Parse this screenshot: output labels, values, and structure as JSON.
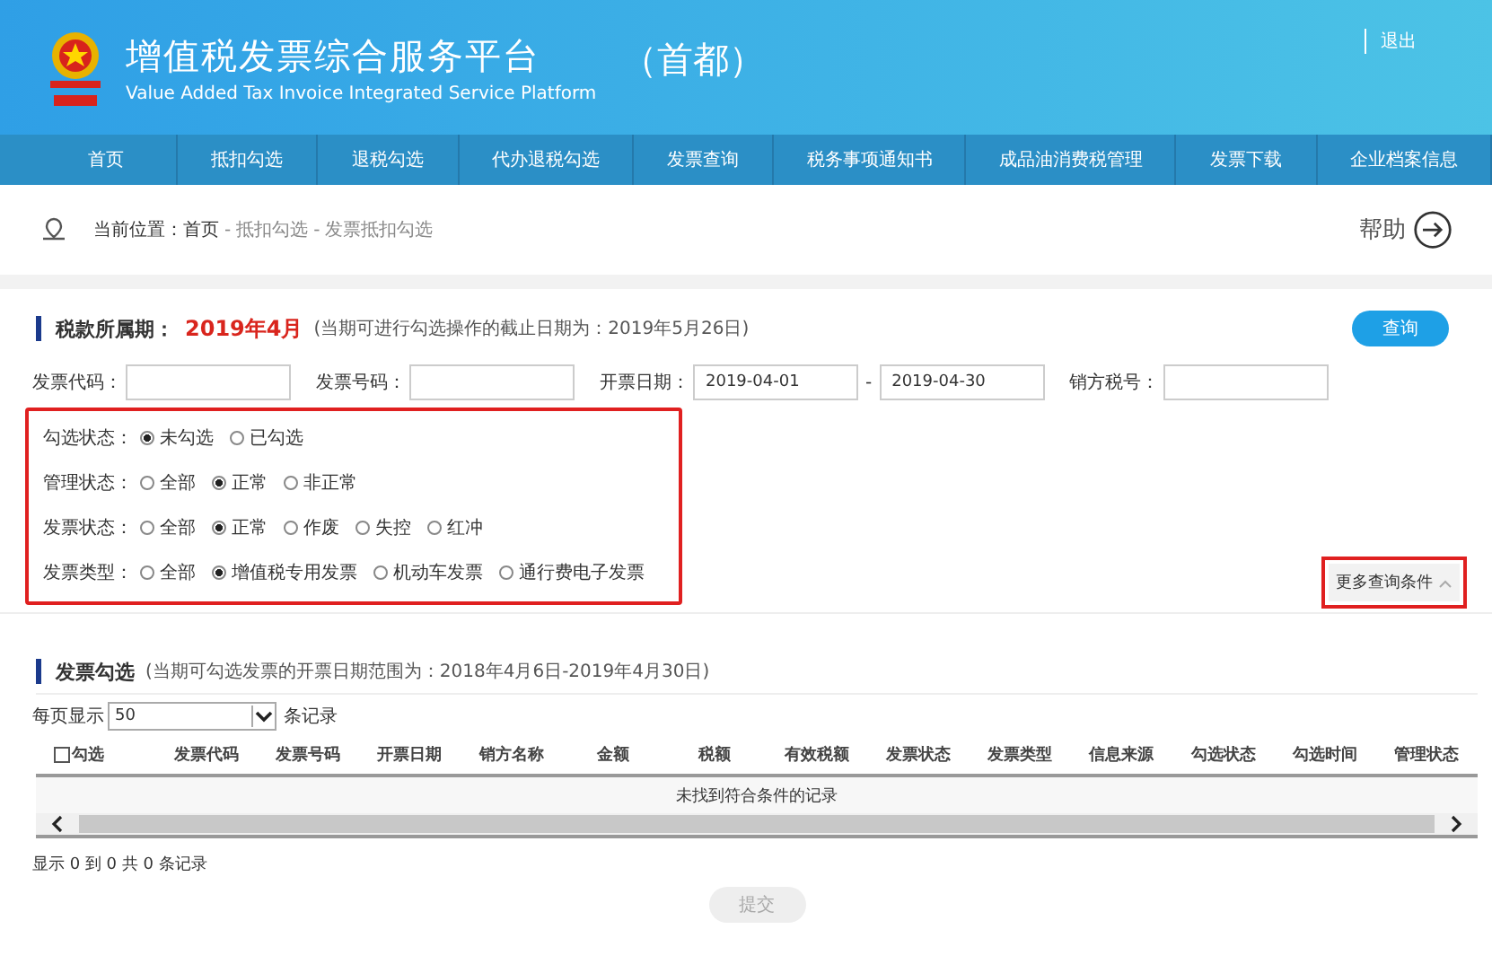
{
  "header": {
    "title": "增值税发票综合服务平台",
    "subtitle": "Value Added Tax Invoice Integrated Service Platform",
    "region": "（首都）",
    "logout": "退出"
  },
  "nav": [
    {
      "label": "首页",
      "selected": false
    },
    {
      "label": "抵扣勾选",
      "selected": false
    },
    {
      "label": "退税勾选",
      "selected": false
    },
    {
      "label": "代办退税勾选",
      "selected": false
    },
    {
      "label": "发票查询",
      "selected": false
    },
    {
      "label": "税务事项通知书",
      "selected": false
    },
    {
      "label": "成品油消费税管理",
      "selected": false
    },
    {
      "label": "发票下载",
      "selected": false
    },
    {
      "label": "企业档案信息",
      "selected": false
    }
  ],
  "breadcrumb": {
    "label": "当前位置：",
    "items": [
      "首页",
      "抵扣勾选",
      "发票抵扣勾选"
    ],
    "separator": "-",
    "help": "帮助"
  },
  "period": {
    "label": "税款所属期：",
    "value": "2019年4月",
    "note": "(当期可进行勾选操作的截止日期为：2019年5月26日)",
    "query_button": "查询"
  },
  "fields": [
    {
      "label": "发票代码："
    },
    {
      "label": "发票号码："
    },
    {
      "label": "开票日期：",
      "value": "2019-04-01",
      "separator": "-",
      "value2": "2019-04-30"
    },
    {
      "label": "销方税号："
    }
  ],
  "radio_groups": [
    {
      "label": "勾选状态：",
      "options": [
        {
          "label": "未勾选",
          "selected": true
        },
        {
          "label": "已勾选",
          "selected": false
        }
      ]
    },
    {
      "label": "管理状态：",
      "options": [
        {
          "label": "全部",
          "selected": false
        },
        {
          "label": "正常",
          "selected": true
        },
        {
          "label": "非正常",
          "selected": false
        }
      ]
    },
    {
      "label": "发票状态：",
      "options": [
        {
          "label": "全部",
          "selected": false
        },
        {
          "label": "正常",
          "selected": true
        },
        {
          "label": "作废",
          "selected": false
        },
        {
          "label": "失控",
          "selected": false
        },
        {
          "label": "红冲",
          "selected": false
        }
      ]
    },
    {
      "label": "发票类型：",
      "options": [
        {
          "label": "全部",
          "selected": false
        },
        {
          "label": "增值税专用发票",
          "selected": true
        },
        {
          "label": "机动车发票",
          "selected": false
        },
        {
          "label": "通行费电子发票",
          "selected": false
        }
      ]
    }
  ],
  "more_conditions": "更多查询条件",
  "invoice_section": {
    "title": "发票勾选",
    "note": "(当期可勾选发票的开票日期范围为：2018年4月6日-2019年4月30日)",
    "page_size_label": "每页显示",
    "page_size": "50",
    "page_size_suffix": "条记录"
  },
  "table": {
    "select_all": {
      "label": "勾选",
      "checked": false
    },
    "columns": [
      "发票代码",
      "发票号码",
      "开票日期",
      "销方名称",
      "金额",
      "税额",
      "有效税额",
      "发票状态",
      "发票类型",
      "信息来源",
      "勾选状态",
      "勾选时间",
      "管理状态"
    ],
    "empty": "未找到符合条件的记录"
  },
  "pagination": "显示 0 到 0 共 0 条记录",
  "submit": {
    "label": "提交",
    "disabled": true
  }
}
